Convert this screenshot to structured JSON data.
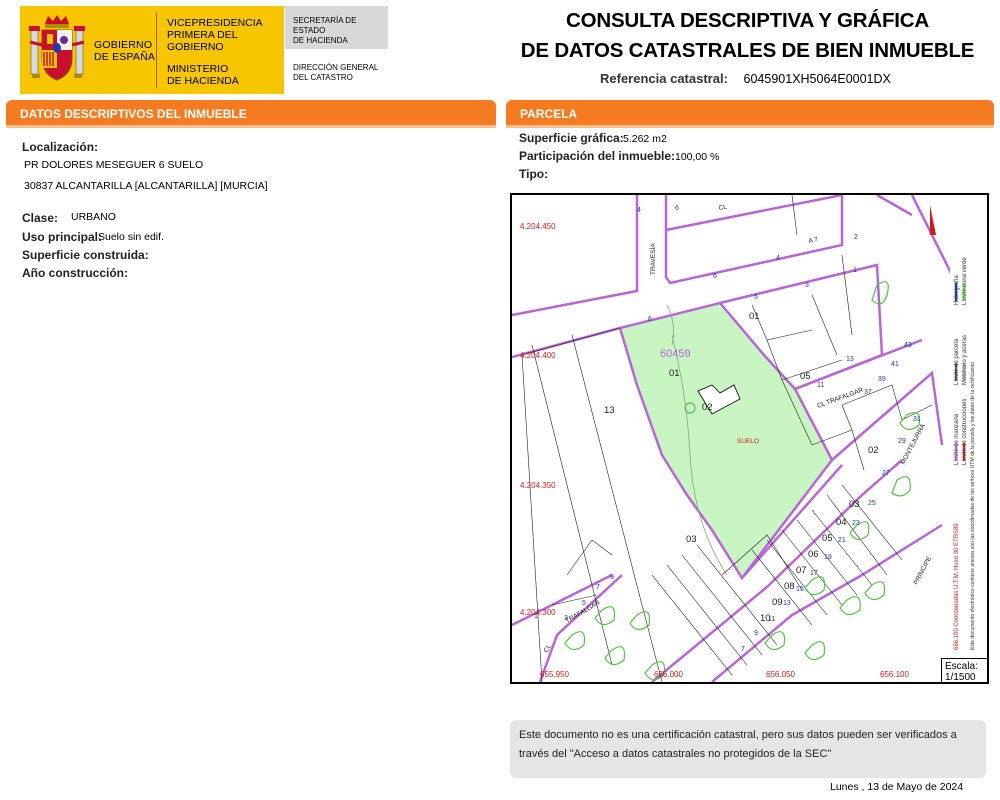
{
  "header": {
    "gov_line1": "GOBIERNO",
    "gov_line2": "DE ESPAÑA",
    "vice_line1": "VICEPRESIDENCIA",
    "vice_line2": "PRIMERA DEL GOBIERNO",
    "min_line1": "MINISTERIO",
    "min_line2": "DE HACIENDA",
    "sec_line1": "SECRETARÍA DE ESTADO",
    "sec_line2": "DE HACIENDA",
    "dg_line1": "DIRECCIÓN GENERAL",
    "dg_line2": "DEL CATASTRO",
    "title_line1": "CONSULTA DESCRIPTIVA Y GRÁFICA",
    "title_line2": "DE DATOS CATASTRALES DE BIEN INMUEBLE",
    "ref_label": "Referencia catastral:",
    "ref_value": "6045901XH5064E0001DX"
  },
  "colors": {
    "brand_yellow": "#f7c600",
    "section_orange": "#f47b20",
    "parcel_green": "#c9f5c3",
    "boundary_purple": "#b865d8",
    "label_blue": "#1a3fb0",
    "coord_red": "#d11a1a"
  },
  "inmueble": {
    "section_title": "DATOS DESCRIPTIVOS DEL INMUEBLE",
    "loc_label": "Localización:",
    "loc_line1": "PR DOLORES MESEGUER 6 SUELO",
    "loc_line2": "30837 ALCANTARILLA [ALCANTARILLA] [MURCIA]",
    "clase_label": "Clase:",
    "clase_value": "URBANO",
    "uso_label": "Uso principal:",
    "uso_value": "Suelo sin edif.",
    "superficie_label": "Superficie construida:",
    "anio_label": "Año construcción:"
  },
  "parcela": {
    "section_title": "PARCELA",
    "sup_label": "Superficie gráfica:",
    "sup_value": "5.262 m2",
    "part_label": "Participación del inmueble:",
    "part_value": "100,00 %",
    "tipo_label": "Tipo:"
  },
  "map": {
    "y_coords": [
      "4.204.450",
      "4.204.400",
      "4.204.350",
      "4.204.300"
    ],
    "x_coords": [
      "655.950",
      "656.000",
      "656.050",
      "656.100"
    ],
    "parcel_id": "60459",
    "parcel_sub": "01",
    "parcel_sub2": "02",
    "parcel_use": "SUELO",
    "lot_labels": [
      "01",
      "05",
      "13",
      "02",
      "03",
      "04",
      "05",
      "06",
      "07",
      "08",
      "09",
      "10",
      "03"
    ],
    "street_labels": [
      "TRAVESÍA",
      "CL  TRAFALGAR",
      "MONTEJURRA",
      "PRÍNCIPE",
      "TRAFALGAR",
      "CL",
      "CL",
      "A 7"
    ],
    "house_numbers": [
      "4",
      "6",
      "2",
      "4",
      "6",
      "5",
      "3",
      "1",
      "13",
      "11",
      "37",
      "39",
      "41",
      "43",
      "31",
      "29",
      "27",
      "25",
      "23",
      "21",
      "19",
      "17",
      "15",
      "13",
      "11",
      "9",
      "7",
      "1",
      "3",
      "5",
      "7",
      "9",
      "6"
    ],
    "legend": {
      "item1": "Límite de manzana",
      "item2": "Límite de parcela",
      "item3": "Límite de construcciones",
      "item4": "Mobiliario y aceras",
      "item5": "Límite zona verde",
      "item6": "Hidrografía",
      "coords_note": "656.100 Coordenadas U.T.M. Huso 30 ETRS89",
      "validity_note": "Este documento electrónico contiene anexos con las coordenadas de los vértices UTM de la parcela y los datos de la certificación"
    },
    "scale_label": "Escala:",
    "scale_value": "1/1500"
  },
  "footer": {
    "note_line1": "Este documento no es una certificación catastral, pero sus datos pueden ser verificados a",
    "note_line2": "través del \"Acceso a datos catastrales no protegidos de la SEC\"",
    "date": "Lunes , 13 de Mayo de 2024"
  }
}
